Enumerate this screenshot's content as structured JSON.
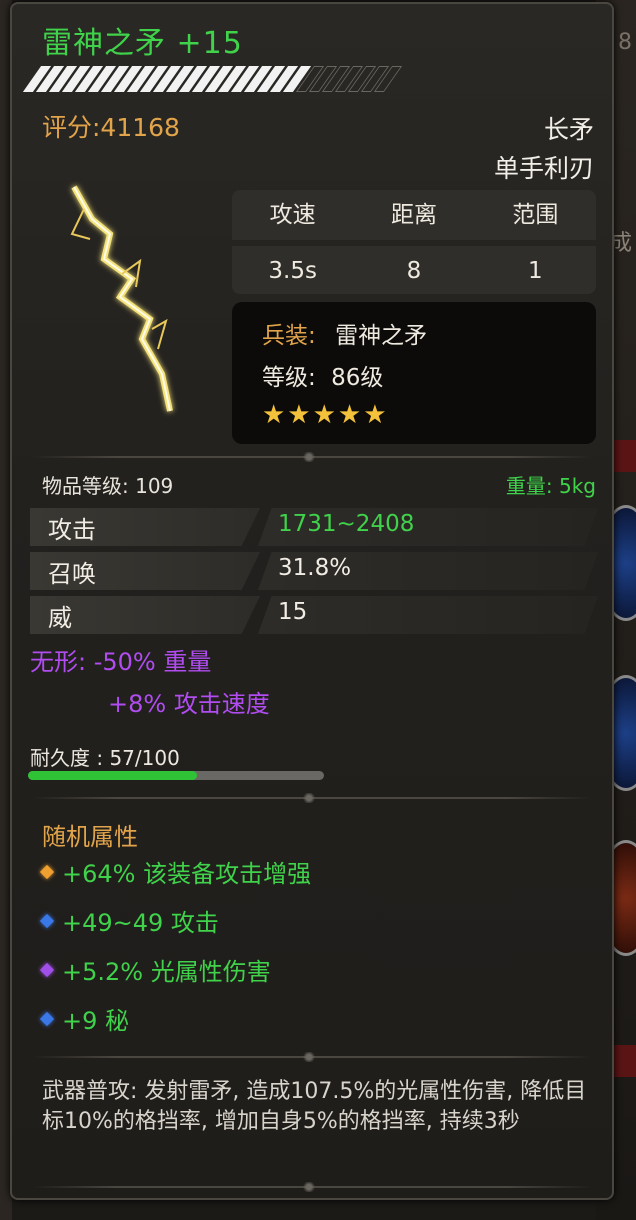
{
  "item": {
    "name": "雷神之矛 +15",
    "score": "评分:41168",
    "type": "长矛",
    "subtype": "单手利刃",
    "stars_filled": 21,
    "stars_total": 28
  },
  "stats_table": {
    "headers": [
      "攻速",
      "距离",
      "范围"
    ],
    "values": [
      "3.5s",
      "8",
      "1"
    ]
  },
  "info": {
    "set_key": "兵装:",
    "set_value": "雷神之矛",
    "level_key": "等级:",
    "level_value": "86级",
    "stars": "★★★★★"
  },
  "item_level": "物品等级: 109",
  "weight": "重量: 5kg",
  "attributes": [
    {
      "label": "攻击",
      "value": "1731~2408"
    },
    {
      "label": "召唤",
      "value": "31.8%"
    },
    {
      "label": "威",
      "value": "15"
    }
  ],
  "special": {
    "line1": "无形: -50% 重量",
    "line2": "+8% 攻击速度"
  },
  "durability": {
    "label": "耐久度 : 57/100",
    "ratio": 0.57
  },
  "random_attrs": {
    "title": "随机属性",
    "items": [
      {
        "text": "+64% 该装备攻击增强",
        "gem_color": "#f0a030"
      },
      {
        "text": "+49~49 攻击",
        "gem_color": "#3a78e8"
      },
      {
        "text": "+5.2% 光属性伤害",
        "gem_color": "#a050e8"
      },
      {
        "text": "+9 秘",
        "gem_color": "#3a78e8"
      }
    ]
  },
  "description": "武器普攻: 发射雷矛, 造成107.5%的光属性伤害, 降低目标10%的格挡率, 增加自身5%的格挡率, 持续3秒",
  "background": {
    "right_char_1": "8",
    "right_char_2": "成"
  },
  "colors": {
    "green": "#3fd24a",
    "gold": "#e2a44a",
    "purple": "#b04cf0",
    "star": "#f4c13a"
  }
}
